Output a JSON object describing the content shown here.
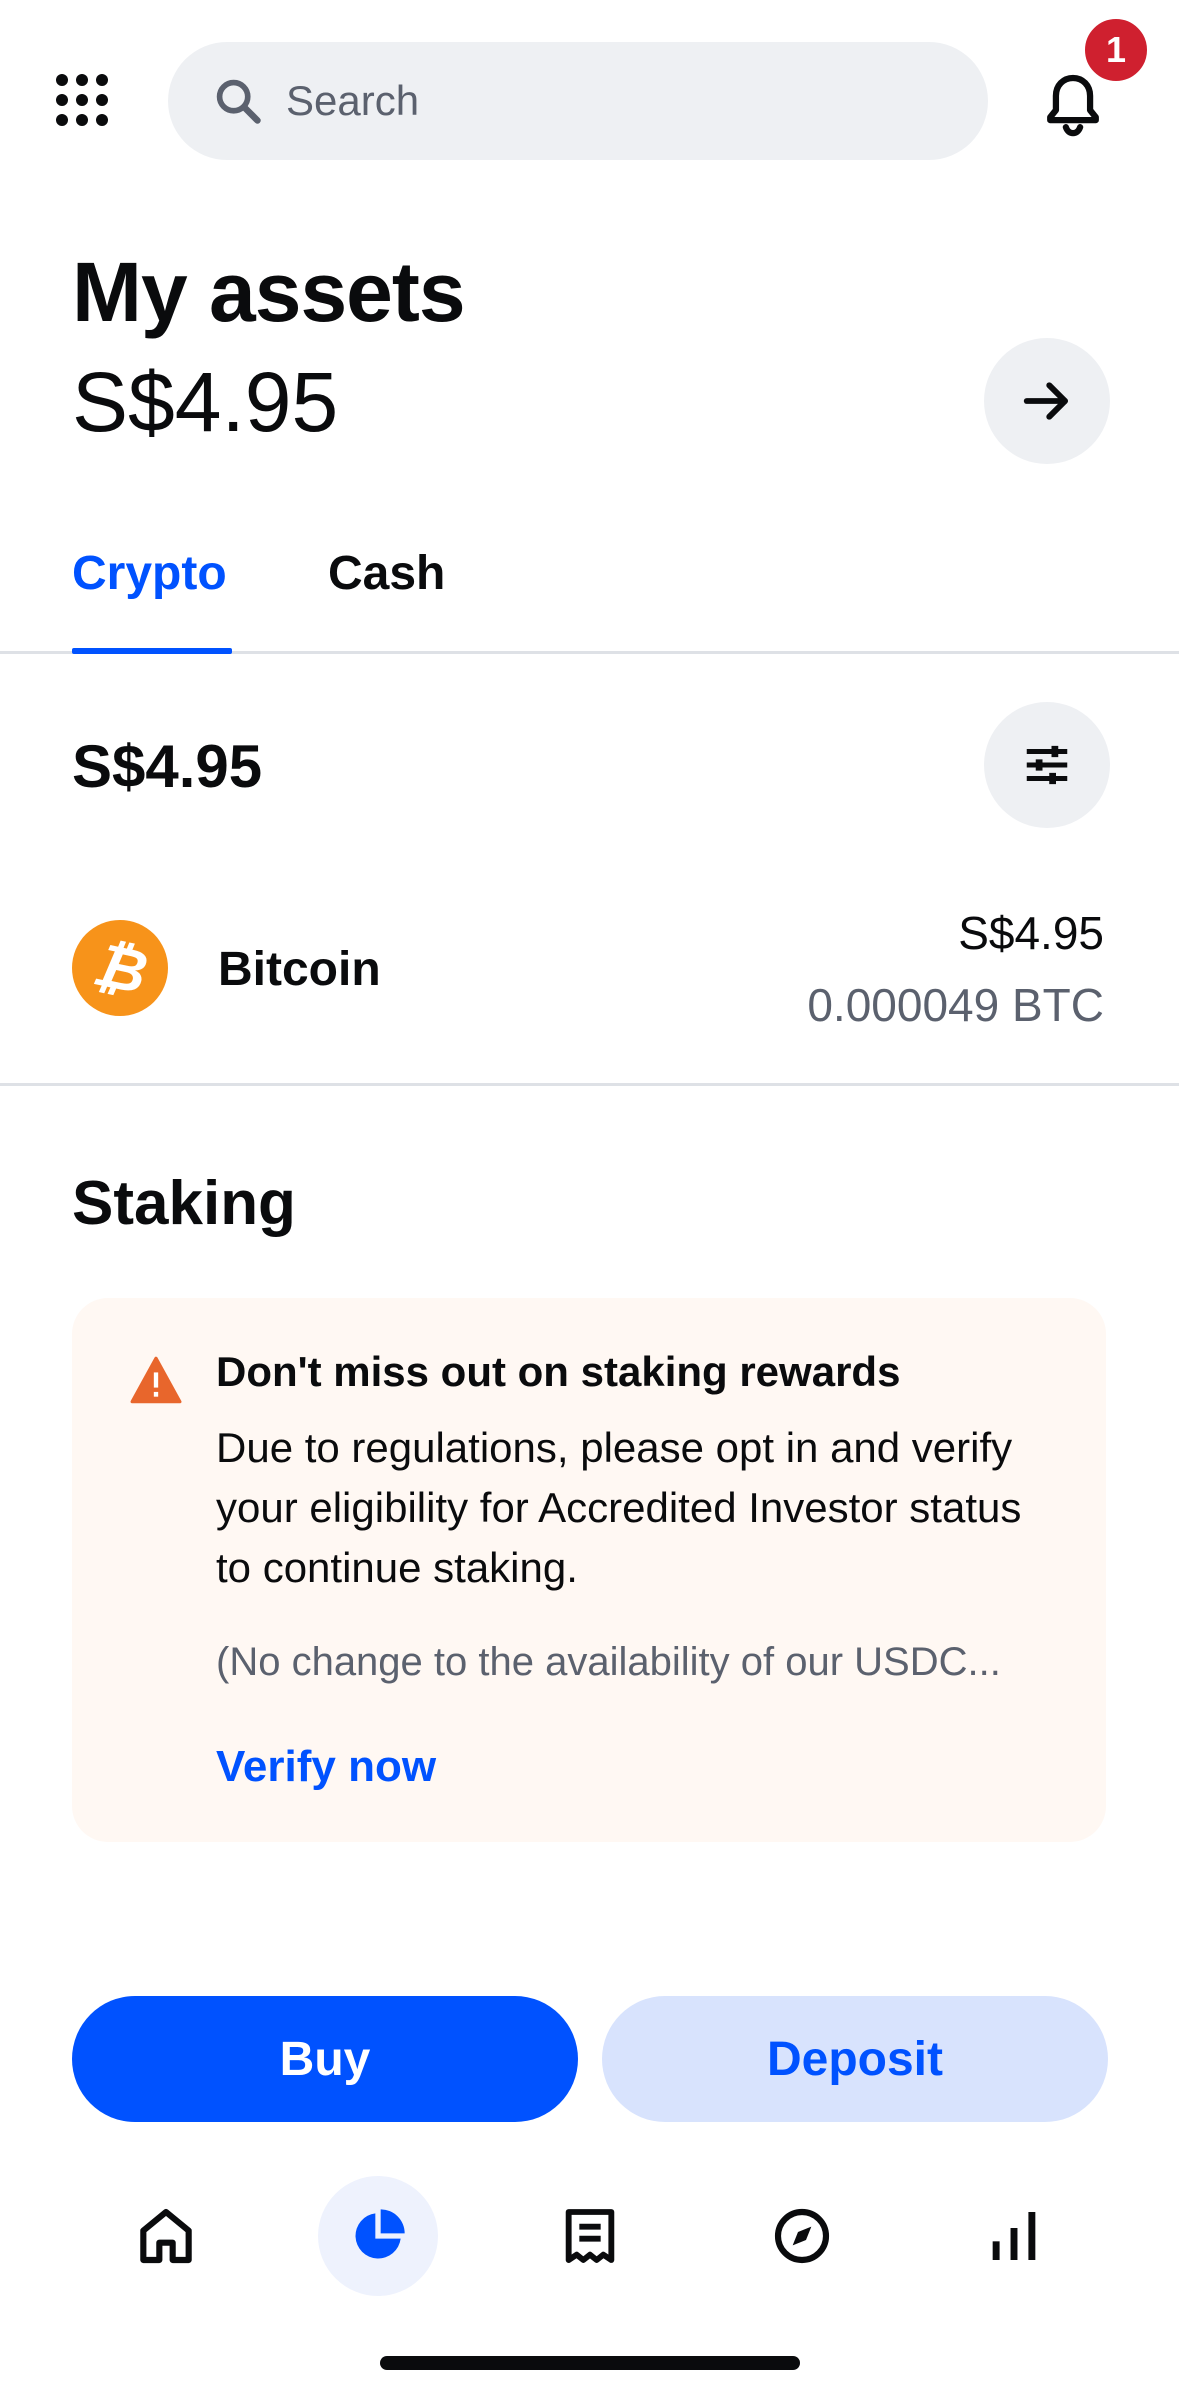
{
  "header": {
    "search_placeholder": "Search",
    "notification_count": "1"
  },
  "assets": {
    "title": "My assets",
    "total_balance": "S$4.95"
  },
  "tabs": [
    {
      "label": "Crypto",
      "active": true
    },
    {
      "label": "Cash",
      "active": false
    }
  ],
  "crypto": {
    "balance": "S$4.95",
    "items": [
      {
        "name": "Bitcoin",
        "symbol_glyph": "₿",
        "fiat_value": "S$4.95",
        "amount": "0.000049 BTC",
        "color": "#f7931a"
      }
    ]
  },
  "staking": {
    "title": "Staking",
    "notice_title": "Don't miss out on staking rewards",
    "notice_body": "Due to regulations, please opt in and verify your eligibility for Accredited Investor status to continue staking.",
    "notice_footer": "(No change to the availability of our USDC...",
    "cta": "Verify now"
  },
  "actions": {
    "buy_label": "Buy",
    "deposit_label": "Deposit"
  },
  "nav": {
    "items": [
      {
        "icon": "home-icon",
        "active": false
      },
      {
        "icon": "portfolio-pie-icon",
        "active": true
      },
      {
        "icon": "transactions-receipt-icon",
        "active": false
      },
      {
        "icon": "explore-compass-icon",
        "active": false
      },
      {
        "icon": "markets-bars-icon",
        "active": false
      }
    ]
  },
  "colors": {
    "brand_blue": "#0052ff",
    "bitcoin_orange": "#f7931a",
    "badge_red": "#cf202f",
    "warning_orange": "#e8662c"
  }
}
